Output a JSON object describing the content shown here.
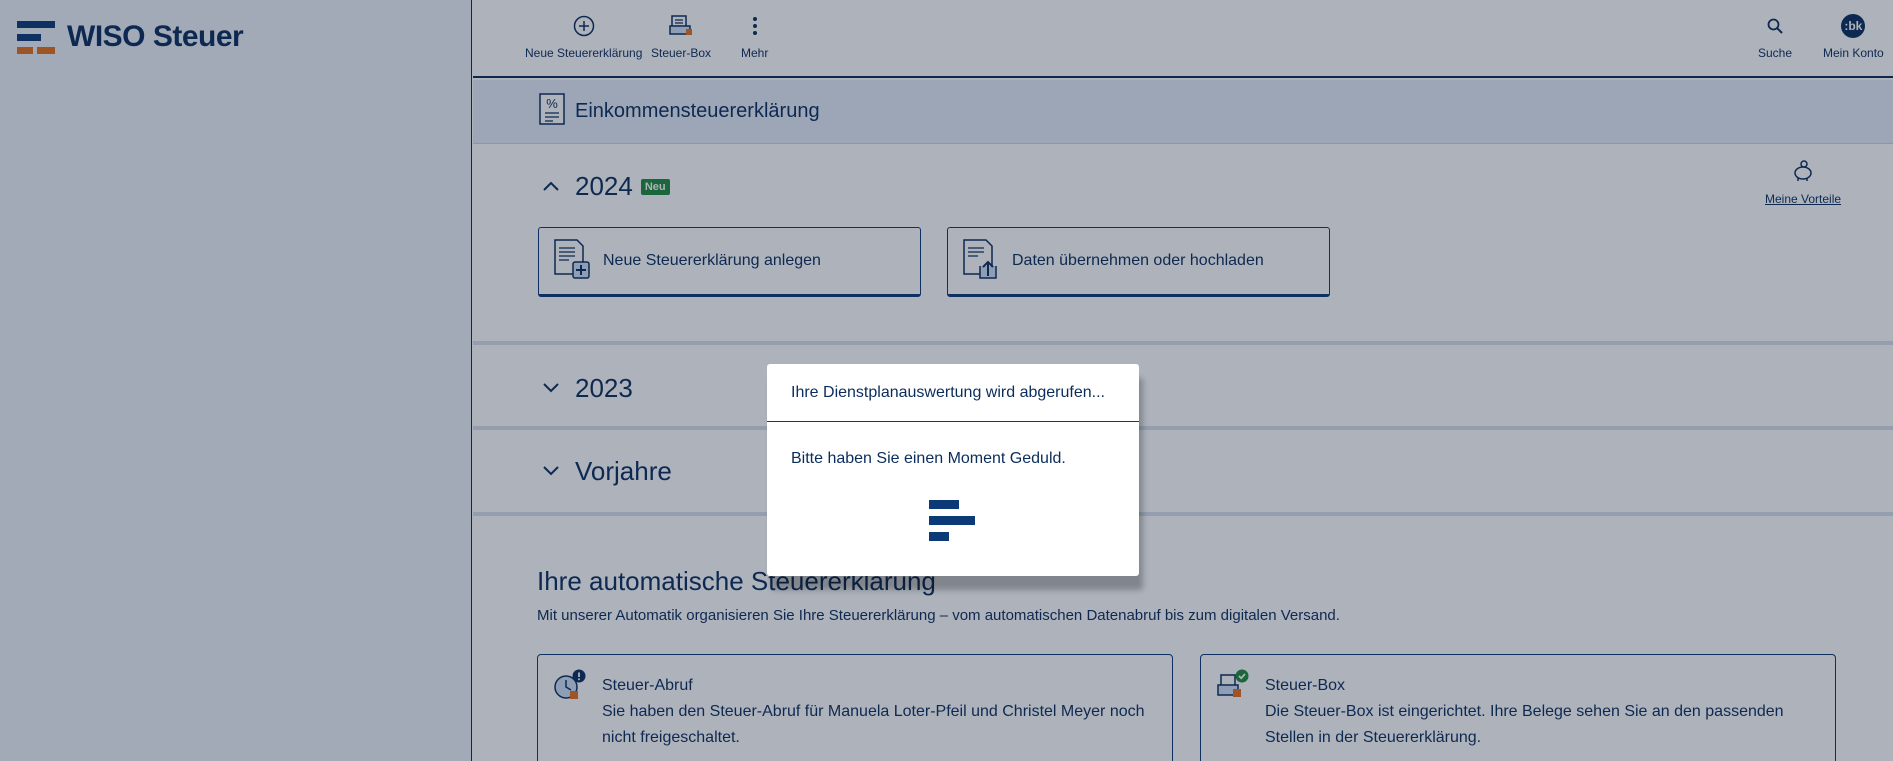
{
  "app": {
    "name": "WISO Steuer"
  },
  "topbar": {
    "new_label": "Neue Steuererklärung",
    "box_label": "Steuer-Box",
    "more_label": "Mehr",
    "search_label": "Suche",
    "account_label": "Mein Konto",
    "avatar_initials": ":bk"
  },
  "page": {
    "title": "Einkommensteuererklärung"
  },
  "years": {
    "current": {
      "label": "2024",
      "badge": "Neu"
    },
    "prev": {
      "label": "2023"
    },
    "older": {
      "label": "Vorjahre"
    }
  },
  "actions": {
    "new_return": "Neue Steuererklärung anlegen",
    "upload": "Daten übernehmen oder hochladen",
    "vorteile": "Meine Vorteile"
  },
  "automatic": {
    "title": "Ihre automatische Steuererklärung",
    "subtitle": "Mit unserer Automatik organisieren Sie Ihre Steuererklärung – vom automatischen Datenabruf bis zum digitalen Versand.",
    "abruf_title": "Steuer-Abruf",
    "abruf_text": "Sie haben den Steuer-Abruf für Manuela Loter-Pfeil und Christel Meyer noch nicht freigeschaltet.",
    "box_title": "Steuer-Box",
    "box_text": "Die Steuer-Box ist eingerichtet. Ihre Belege sehen Sie an den passenden Stellen in der Steuererklärung."
  },
  "modal": {
    "title": "Ihre Dienstplanauswertung wird abgerufen...",
    "message": "Bitte haben Sie einen Moment Geduld."
  },
  "colors": {
    "primary": "#0b2d5c",
    "accent": "#e8701a",
    "success": "#1f8a3a"
  }
}
